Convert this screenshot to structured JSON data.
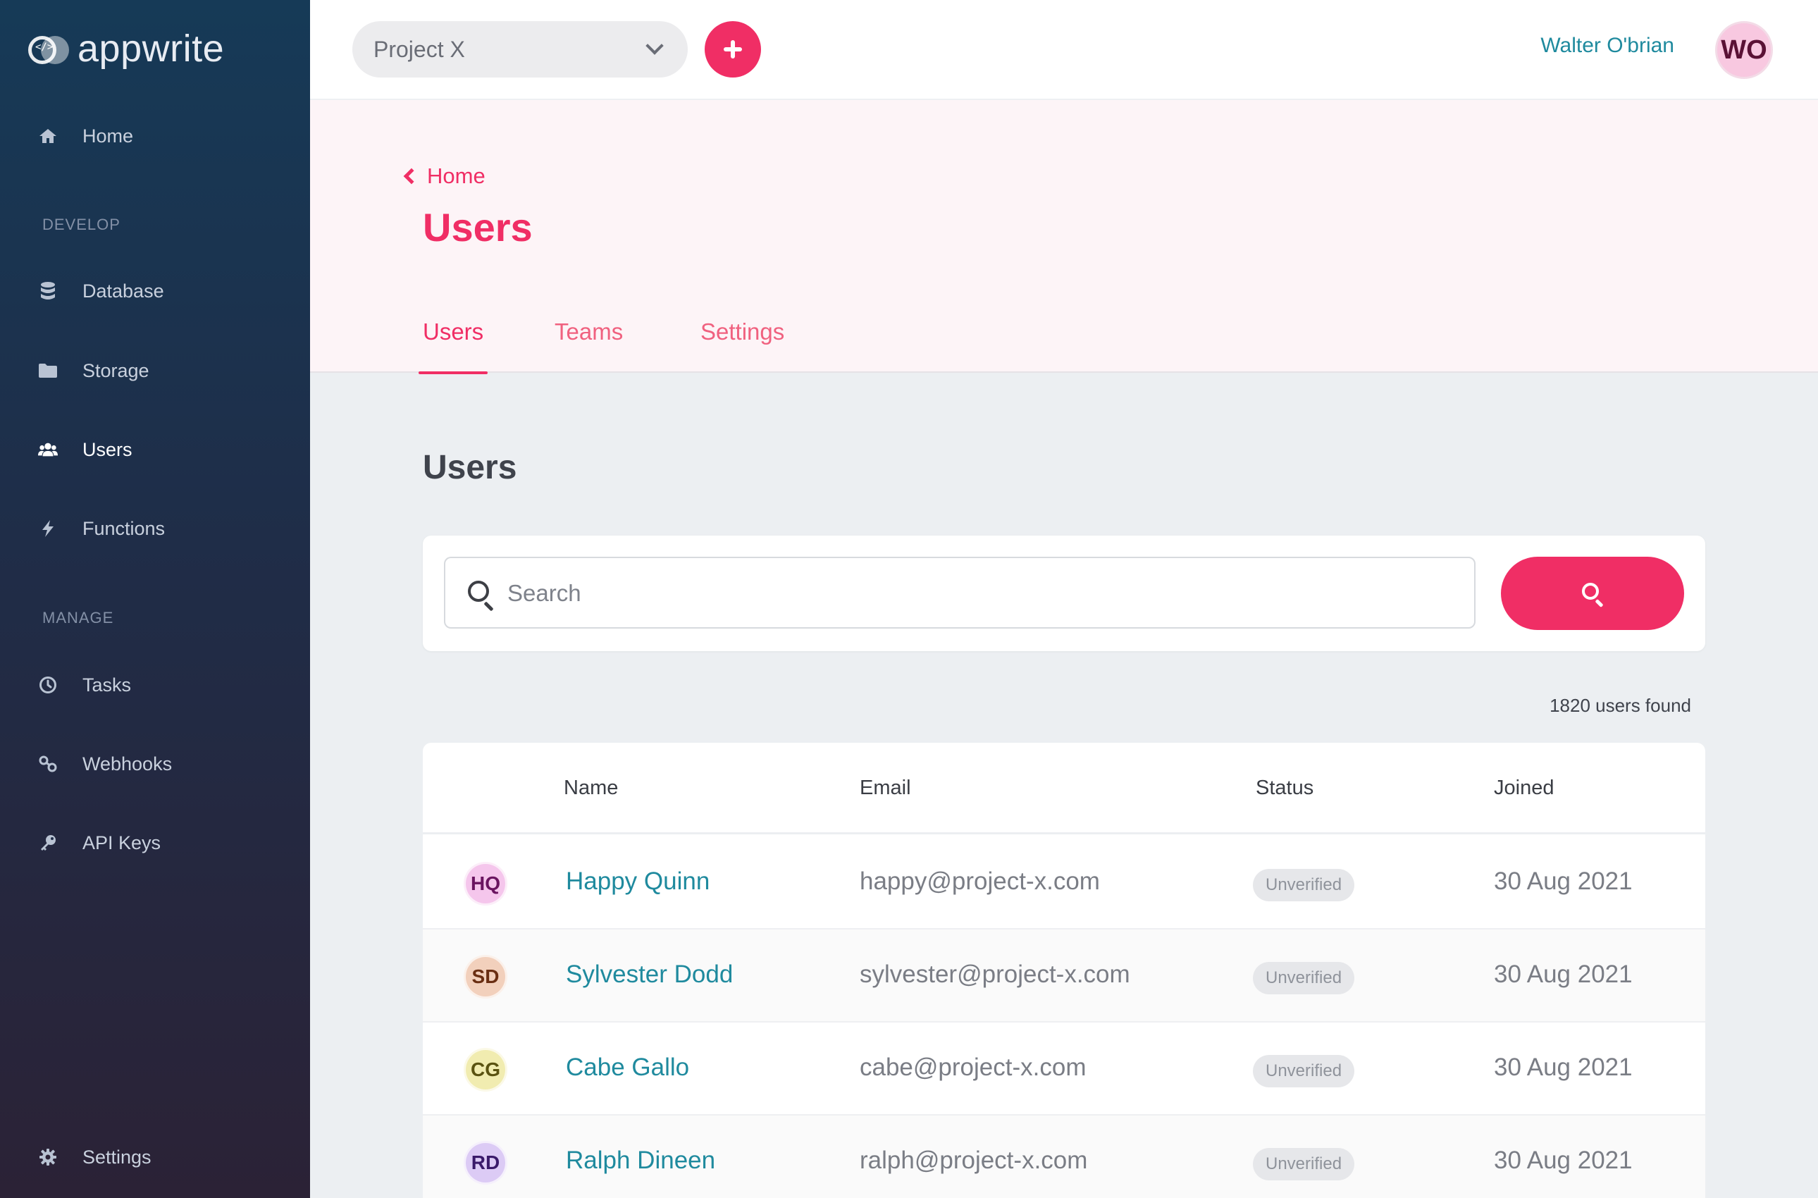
{
  "brand": {
    "name": "appwrite"
  },
  "sidebar": {
    "items": [
      {
        "label": "Home",
        "icon": "home-icon"
      },
      {
        "label": "Database",
        "icon": "database-icon"
      },
      {
        "label": "Storage",
        "icon": "folder-icon"
      },
      {
        "label": "Users",
        "icon": "users-icon"
      },
      {
        "label": "Functions",
        "icon": "bolt-icon"
      },
      {
        "label": "Tasks",
        "icon": "clock-icon"
      },
      {
        "label": "Webhooks",
        "icon": "link-icon"
      },
      {
        "label": "API Keys",
        "icon": "key-icon"
      },
      {
        "label": "Settings",
        "icon": "gear-icon"
      }
    ],
    "sections": {
      "develop": "DEVELOP",
      "manage": "MANAGE"
    },
    "active": "Users"
  },
  "topbar": {
    "project": "Project X",
    "user_name": "Walter O'brian",
    "user_initials": "WO"
  },
  "header": {
    "back_label": "Home",
    "title": "Users",
    "tabs": [
      {
        "label": "Users",
        "active": true
      },
      {
        "label": "Teams",
        "active": false
      },
      {
        "label": "Settings",
        "active": false
      }
    ]
  },
  "content": {
    "section_title": "Users",
    "search": {
      "placeholder": "Search",
      "value": ""
    },
    "found_text": "1820 users found",
    "table": {
      "columns": [
        "Name",
        "Email",
        "Status",
        "Joined"
      ],
      "rows": [
        {
          "initials": "HQ",
          "name": "Happy Quinn",
          "email": "happy@project-x.com",
          "status": "Unverified",
          "joined": "30 Aug 2021",
          "avatar_bg": "#f5c6ec",
          "avatar_fg": "#6a1460"
        },
        {
          "initials": "SD",
          "name": "Sylvester Dodd",
          "email": "sylvester@project-x.com",
          "status": "Unverified",
          "joined": "30 Aug 2021",
          "avatar_bg": "#f2d0bc",
          "avatar_fg": "#6a2e12"
        },
        {
          "initials": "CG",
          "name": "Cabe Gallo",
          "email": "cabe@project-x.com",
          "status": "Unverified",
          "joined": "30 Aug 2021",
          "avatar_bg": "#f1ecb0",
          "avatar_fg": "#5a5210"
        },
        {
          "initials": "RD",
          "name": "Ralph Dineen",
          "email": "ralph@project-x.com",
          "status": "Unverified",
          "joined": "30 Aug 2021",
          "avatar_bg": "#dccbf5",
          "avatar_fg": "#3a1a6a"
        }
      ]
    }
  },
  "colors": {
    "accent": "#f02e65",
    "link": "#1f8a9e",
    "sidebar_top": "#163a57",
    "sidebar_bottom": "#2b2236"
  }
}
